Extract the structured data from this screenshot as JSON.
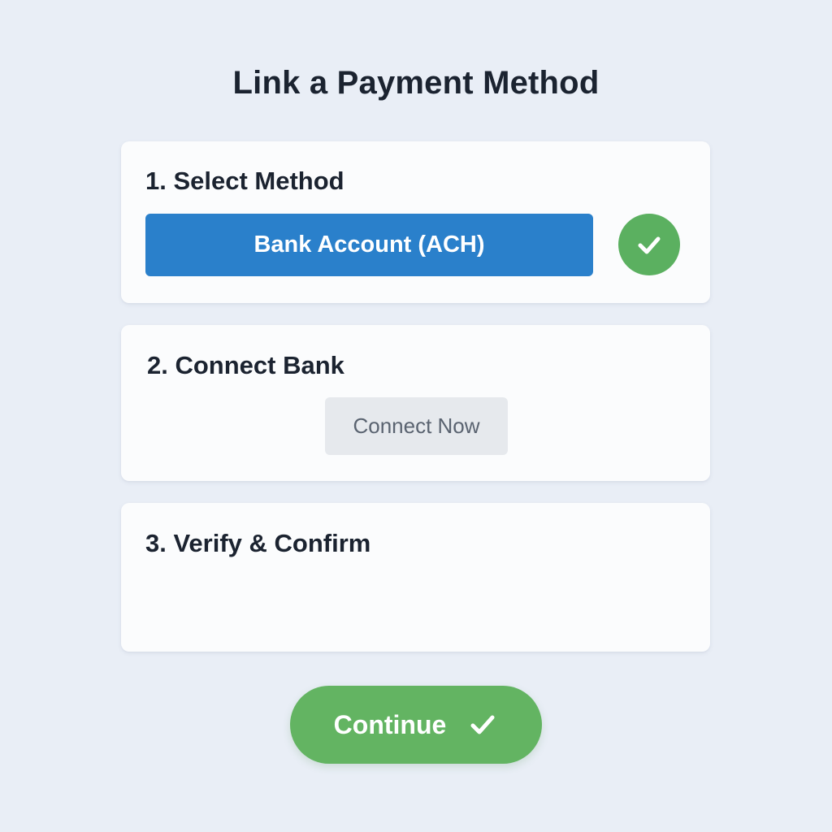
{
  "page": {
    "title": "Link a Payment Method"
  },
  "steps": [
    {
      "heading": "1. Select Method",
      "selected_method": "Bank Account (ACH)",
      "completed": true
    },
    {
      "heading": "2. Connect Bank",
      "button_label": "Connect Now"
    },
    {
      "heading": "3. Verify & Confirm"
    }
  ],
  "footer": {
    "continue_label": "Continue"
  },
  "icons": {
    "step1_status": "check-icon",
    "continue": "check-icon"
  },
  "colors": {
    "background": "#e9eef6",
    "primary_blue": "#2a80cb",
    "success_green": "#5bb060",
    "card": "#fbfcfd",
    "secondary_button": "#e6e9ed"
  }
}
